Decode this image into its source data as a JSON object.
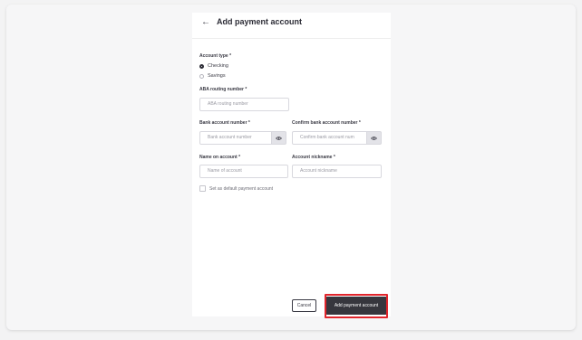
{
  "header": {
    "back_icon": "arrow-left-icon",
    "title": "Add payment account"
  },
  "form": {
    "account_type": {
      "label": "Account type",
      "required_mark": "*",
      "options": [
        {
          "label": "Checking",
          "selected": true
        },
        {
          "label": "Savings",
          "selected": false
        }
      ]
    },
    "routing": {
      "label": "ABA routing number",
      "required_mark": "*",
      "placeholder": "ABA routing number"
    },
    "account_number": {
      "label": "Bank account number",
      "required_mark": "*",
      "placeholder": "Bank account number",
      "toggle_icon": "eye-icon"
    },
    "confirm_account_number": {
      "label": "Confirm bank account number",
      "required_mark": "*",
      "placeholder": "Confirm bank account num",
      "toggle_icon": "eye-icon"
    },
    "name_on_account": {
      "label": "Name on account",
      "required_mark": "*",
      "placeholder": "Name of account"
    },
    "nickname": {
      "label": "Account nickname",
      "required_mark": "*",
      "placeholder": "Account nickname"
    },
    "default_checkbox": {
      "label": "Set as default payment account",
      "checked": false
    }
  },
  "actions": {
    "cancel_label": "Cancel",
    "submit_label": "Add payment account"
  },
  "colors": {
    "highlight": "#e0242b",
    "primary_button": "#36363d"
  }
}
